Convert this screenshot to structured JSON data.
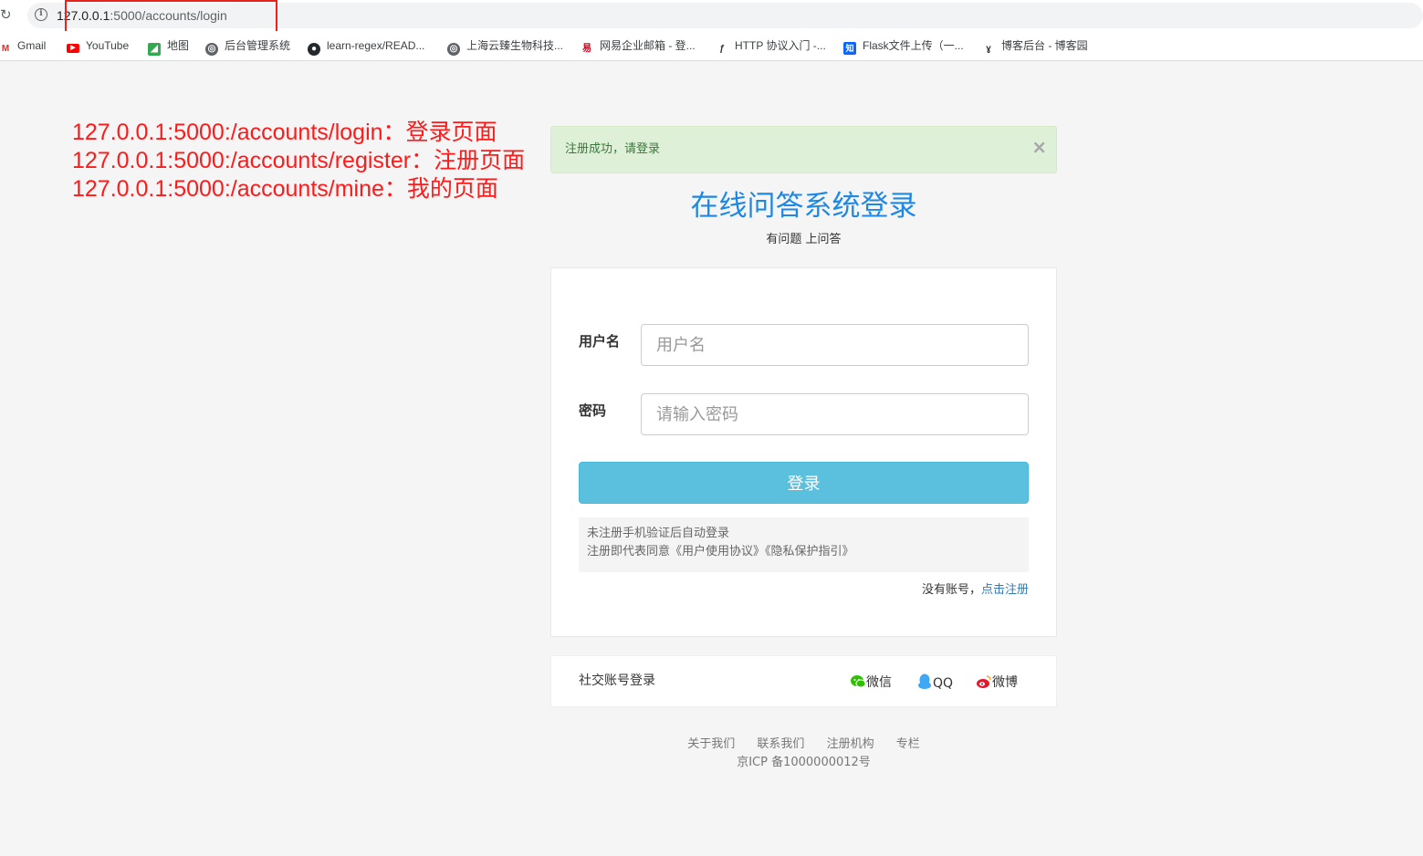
{
  "browser": {
    "url_host": "127.0.0.1",
    "url_rest": ":5000/accounts/login",
    "bookmarks": [
      {
        "label": "Gmail",
        "icon": "gmail-icon"
      },
      {
        "label": "YouTube",
        "icon": "youtube-icon"
      },
      {
        "label": "地图",
        "icon": "maps-icon"
      },
      {
        "label": "后台管理系统",
        "icon": "globe-icon"
      },
      {
        "label": "learn-regex/READ...",
        "icon": "github-icon"
      },
      {
        "label": "上海云臻生物科技...",
        "icon": "globe-icon"
      },
      {
        "label": "网易企业邮箱 - 登...",
        "icon": "netease-icon"
      },
      {
        "label": "HTTP 协议入门 -...",
        "icon": "ruanyifeng-icon"
      },
      {
        "label": "Flask文件上传（一...",
        "icon": "zhihu-icon"
      },
      {
        "label": "博客后台 - 博客园",
        "icon": "cnblogs-icon"
      }
    ]
  },
  "annotations": [
    "127.0.0.1:5000:/accounts/login：登录页面",
    "127.0.0.1:5000:/accounts/register：注册页面",
    "127.0.0.1:5000:/accounts/mine：我的页面"
  ],
  "alert": {
    "text": "注册成功，请登录",
    "close": "×"
  },
  "heading": {
    "title": "在线问答系统登录",
    "subtitle": "有问题 上问答"
  },
  "form": {
    "username_label": "用户名",
    "username_placeholder": "用户名",
    "password_label": "密码",
    "password_placeholder": "请输入密码",
    "submit_label": "登录",
    "notice_line1": "未注册手机验证后自动登录",
    "notice_line2": "注册即代表同意《用户使用协议》《隐私保护指引》",
    "register_prompt": "没有账号，",
    "register_link": "点击注册"
  },
  "social": {
    "title": "社交账号登录",
    "wechat": "微信",
    "qq": "QQ",
    "weibo": "微博"
  },
  "footer": {
    "links": [
      "关于我们",
      "联系我们",
      "注册机构",
      "专栏"
    ],
    "icp": "京ICP 备1000000012号"
  },
  "colors": {
    "accent_blue": "#1e88e5",
    "button_info": "#5bc0de",
    "alert_success_bg": "#dff0d8",
    "annotation_red": "#ff1a1a"
  }
}
